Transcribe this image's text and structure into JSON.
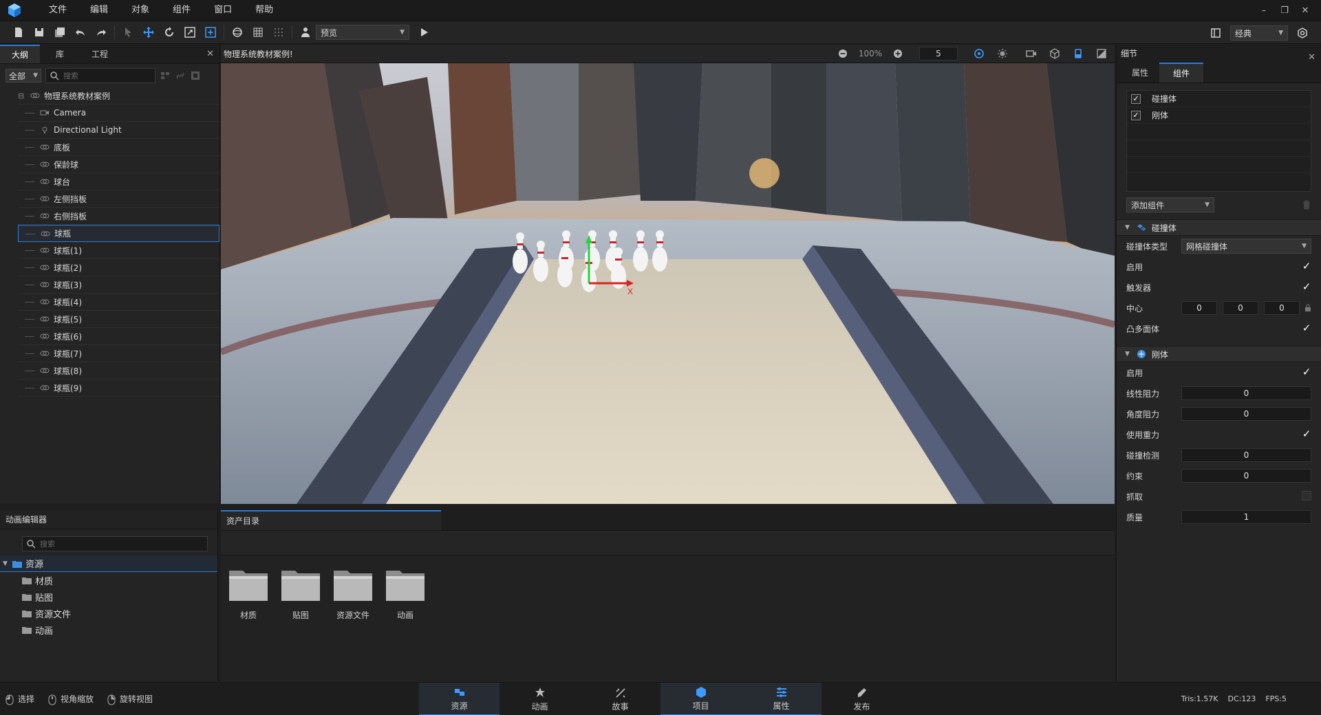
{
  "menubar": {
    "items": [
      "文件",
      "编辑",
      "对象",
      "组件",
      "窗口",
      "帮助"
    ]
  },
  "toolbar": {
    "preview_select": "预览",
    "layout_select": "经典"
  },
  "outline": {
    "tabs": [
      "大纲",
      "库",
      "工程"
    ],
    "filter": "全部",
    "search_placeholder": "搜索",
    "root": "物理系统教材案例",
    "nodes": [
      "Camera",
      "Directional Light",
      "底板",
      "保龄球",
      "球台",
      "左侧挡板",
      "右侧挡板",
      "球瓶",
      "球瓶(1)",
      "球瓶(2)",
      "球瓶(3)",
      "球瓶(4)",
      "球瓶(5)",
      "球瓶(6)",
      "球瓶(7)",
      "球瓶(8)",
      "球瓶(9)"
    ],
    "selected": "球瓶"
  },
  "viewport": {
    "title": "物理系统教材案例!",
    "zoom": "100%",
    "grid_value": "5",
    "axis_x": "X"
  },
  "animation_editor": {
    "title": "动画编辑器",
    "search_placeholder": "搜索",
    "root": "资源",
    "folders": [
      "材质",
      "贴图",
      "资源文件",
      "动画"
    ]
  },
  "assets": {
    "tab": "资产目录",
    "items": [
      "材质",
      "贴图",
      "资源文件",
      "动画"
    ]
  },
  "details": {
    "title": "细节",
    "tabs": [
      "属性",
      "组件"
    ],
    "components": [
      "碰撞体",
      "刚体"
    ],
    "add_component": "添加组件",
    "collider": {
      "title": "碰撞体",
      "type_label": "碰撞体类型",
      "type_value": "网格碰撞体",
      "enabled_label": "启用",
      "trigger_label": "触发器",
      "center_label": "中心",
      "center": [
        "0",
        "0",
        "0"
      ],
      "convex_label": "凸多面体"
    },
    "rigidbody": {
      "title": "刚体",
      "enabled_label": "启用",
      "linear_drag_label": "线性阻力",
      "linear_drag": "0",
      "angular_drag_label": "角度阻力",
      "angular_drag": "0",
      "gravity_label": "使用重力",
      "collision_label": "碰撞检测",
      "collision": "0",
      "constraint_label": "约束",
      "constraint": "0",
      "grab_label": "抓取",
      "mass_label": "质量",
      "mass": "1"
    }
  },
  "statusbar": {
    "hints": [
      "选择",
      "视角缩放",
      "旋转视图"
    ],
    "tabs": [
      "资源",
      "动画",
      "故事",
      "项目",
      "属性",
      "发布"
    ],
    "stats": [
      "Tris:1.57K",
      "DC:123",
      "FPS:5"
    ]
  },
  "colors": {
    "accent": "#2e7bd6",
    "panel": "#252525",
    "background": "#1e1e1e"
  }
}
